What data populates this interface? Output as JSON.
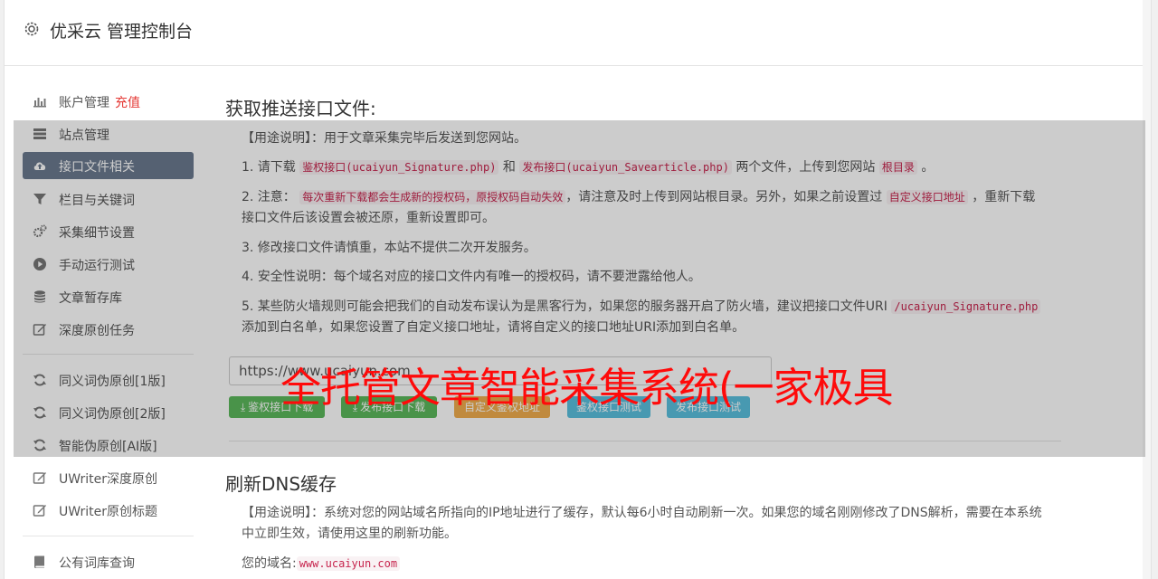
{
  "header": {
    "title": "优采云 管理控制台",
    "icon": "gear-icon"
  },
  "sidebar": {
    "items": [
      {
        "label": "账户管理",
        "extra": "充值",
        "icon": "bar-chart-icon"
      },
      {
        "label": "站点管理",
        "icon": "list-icon"
      },
      {
        "label": "接口文件相关",
        "icon": "cloud-upload-icon",
        "active": true
      },
      {
        "label": "栏目与关键词",
        "icon": "filter-icon"
      },
      {
        "label": "采集细节设置",
        "icon": "cogs-icon"
      },
      {
        "label": "手动运行测试",
        "icon": "play-circle-icon"
      },
      {
        "label": "文章暂存库",
        "icon": "database-icon"
      },
      {
        "label": "深度原创任务",
        "icon": "edit-icon"
      },
      {
        "label": "同义词伪原创[1版]",
        "icon": "refresh-icon"
      },
      {
        "label": "同义词伪原创[2版]",
        "icon": "refresh-icon"
      },
      {
        "label": "智能伪原创[AI版]",
        "icon": "refresh-icon"
      },
      {
        "label": "UWriter深度原创",
        "icon": "edit-icon"
      },
      {
        "label": "UWriter原创标题",
        "icon": "edit-icon"
      },
      {
        "label": "公有词库查询",
        "icon": "book-icon"
      }
    ]
  },
  "section1": {
    "title": "获取推送接口文件:",
    "usage": "【用途说明】：用于文章采集完毕后发送到您网站。",
    "p1": {
      "pre": "1. 请下载",
      "code1": "鉴权接口(ucaiyun_Signature.php)",
      "mid": "和",
      "code2": "发布接口(ucaiyun_Savearticle.php)",
      "post": "两个文件，上传到您网站",
      "code3": "根目录",
      "end": "。"
    },
    "p2": {
      "pre": "2. 注意：",
      "code1": "每次重新下载都会生成新的授权码，原授权码自动失效",
      "mid": "，请注意及时上传到网站根目录。另外，如果之前设置过",
      "code2": "自定义接口地址",
      "post": "，重新下载接口文件后该设置会被还原，重新设置即可。"
    },
    "p3": "3. 修改接口文件请慎重，本站不提供二次开发服务。",
    "p4": "4. 安全性说明：每个域名对应的接口文件内有唯一的授权码，请不要泄露给他人。",
    "p5": {
      "pre": "5. 某些防火墙规则可能会把我们的自动发布误认为是黑客行为，如果您的服务器开启了防火墙，建议把接口文件URI",
      "code1": "/ucaiyun_Signature.php",
      "post": "添加到白名单，如果您设置了自定义接口地址，请将自定义的接口地址URI添加到白名单。"
    },
    "url_value": "https://www.ucaiyun.com",
    "buttons": [
      {
        "label": "鉴权接口下载",
        "icon": "download-icon",
        "color": "#5cb85c"
      },
      {
        "label": "发布接口下载",
        "icon": "download-icon",
        "color": "#5cb85c"
      },
      {
        "label": "自定义鉴权地址",
        "icon": "",
        "color": "#f0ad4e"
      },
      {
        "label": "鉴权接口测试",
        "icon": "",
        "color": "#5bc0de"
      },
      {
        "label": "发布接口测试",
        "icon": "",
        "color": "#5bc0de"
      }
    ]
  },
  "section2": {
    "title": "刷新DNS缓存",
    "usage": "【用途说明】：系统对您的网站域名所指向的IP地址进行了缓存，默认每6小时自动刷新一次。如果您的域名刚刚修改了DNS解析，需要在本系统中立即生效，请使用这里的刷新功能。",
    "domain_label": "您的域名:",
    "domain_value": "www.ucaiyun.com"
  },
  "overlay_banner": "全托管文章智能采集系统(一家极具"
}
